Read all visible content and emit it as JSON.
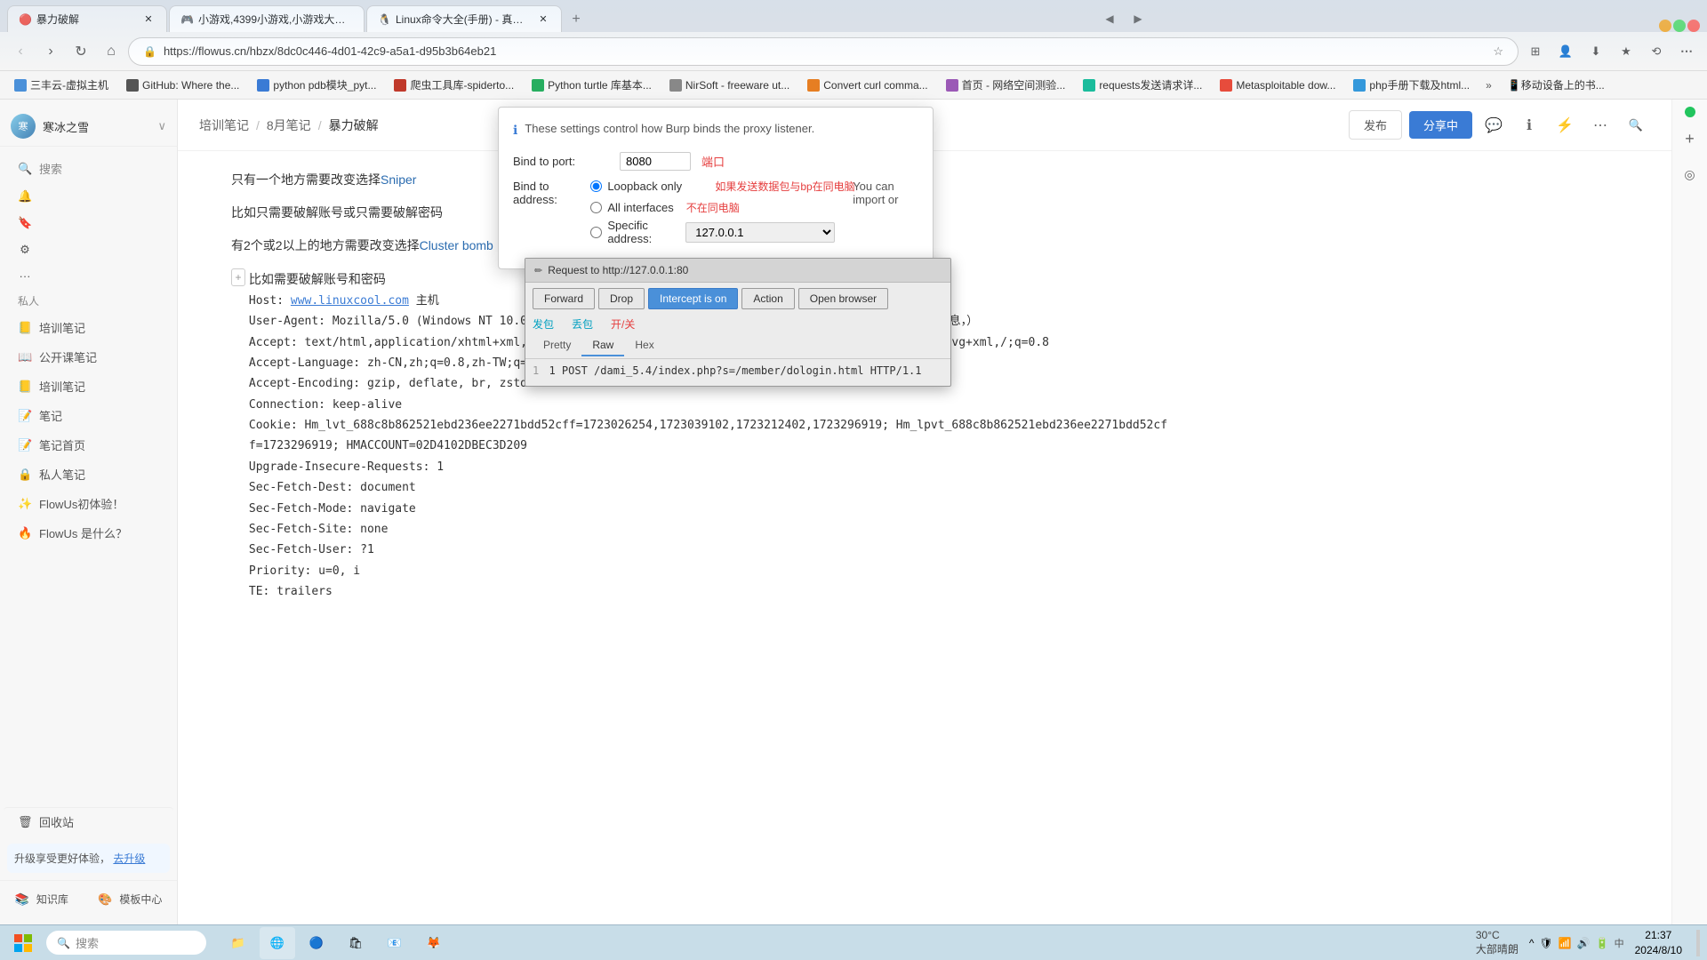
{
  "browser": {
    "tabs": [
      {
        "id": "tab1",
        "title": "暴力破解",
        "active": true,
        "favicon": "🔴"
      },
      {
        "id": "tab2",
        "title": "小游戏,4399小游戏,小游戏大全...",
        "active": false,
        "favicon": "🎮"
      },
      {
        "id": "tab3",
        "title": "Linux命令大全(手册) - 真正好...",
        "active": false,
        "favicon": "🐧"
      }
    ],
    "url": "https://flowus.cn/hbzx/8dc0c446-4d01-42c9-a5a1-d95b3b64eb21",
    "bookmarks": [
      "三丰云-虚拟主机",
      "GitHub: Where the...",
      "python pdb模块_pyt...",
      "爬虫工具库-spiderto...",
      "Python turtle 库基本...",
      "NirSoft - freeware ut...",
      "Convert curl comma...",
      "首页 - 网络空间测验...",
      "requests发送请求详...",
      "Metasploitable dow...",
      "php手册下载及html..."
    ]
  },
  "sidebar": {
    "user": {
      "name": "寒冰之雪",
      "avatar_text": "寒"
    },
    "sections": {
      "private_header": "私人",
      "items": [
        {
          "id": "training-notes",
          "label": "培训笔记",
          "icon": "📒"
        },
        {
          "id": "public-course",
          "label": "公开课笔记",
          "icon": "📖"
        },
        {
          "id": "training-notes2",
          "label": "培训笔记",
          "icon": "📒"
        },
        {
          "id": "notes",
          "label": "笔记",
          "icon": "📝"
        },
        {
          "id": "notes-home",
          "label": "笔记首页",
          "icon": "🏠"
        },
        {
          "id": "private-notes",
          "label": "私人笔记",
          "icon": "🔒"
        },
        {
          "id": "flowus-trial",
          "label": "FlowUs初体验！",
          "icon": "✨"
        },
        {
          "id": "what-is-flowus",
          "label": "FlowUs 是什么？",
          "icon": "❓"
        }
      ]
    },
    "trash": "回收站",
    "upgrade": {
      "text": "升级享受更好体验，",
      "btn_label": "去升级"
    },
    "library": {
      "knowledge": "知识库",
      "template_center": "模板中心"
    }
  },
  "breadcrumb": {
    "items": [
      "培训笔记",
      "8月笔记",
      "暴力破解"
    ]
  },
  "header_actions": {
    "publish_label": "发布",
    "share_label": "分享中",
    "comment_icon": "comment-icon",
    "info_icon": "info-icon",
    "lightning_icon": "lightning-icon",
    "more_icon": "more-icon",
    "search_icon": "search-icon"
  },
  "burp_settings": {
    "info_text": "These settings control how Burp binds the proxy listener.",
    "bind_port_label": "Bind to port:",
    "bind_port_value": "8080",
    "bind_address_label": "Bind to address:",
    "loopback_label": "Loopback only",
    "all_interfaces_label": "All interfaces",
    "specific_address_label": "Specific address:",
    "specific_address_value": "127.0.0.1",
    "annotation_port": "端口",
    "annotation_same_pc": "如果发送数据包与bp在同电脑",
    "annotation_diff_pc": "不在同电脑",
    "right_text": "You can import or"
  },
  "request_popup": {
    "title": "Request to http://127.0.0.1:80",
    "buttons": [
      {
        "id": "forward-btn",
        "label": "Forward"
      },
      {
        "id": "drop-btn",
        "label": "Drop"
      },
      {
        "id": "intercept-btn",
        "label": "Intercept is on",
        "primary": true
      },
      {
        "id": "action-btn",
        "label": "Action"
      },
      {
        "id": "open-browser-btn",
        "label": "Open browser"
      }
    ],
    "tabs": [
      {
        "id": "pretty-tab",
        "label": "Pretty"
      },
      {
        "id": "raw-tab",
        "label": "Raw"
      },
      {
        "id": "hex-tab",
        "label": "Hex"
      }
    ],
    "annotations": [
      {
        "text": "发包",
        "color": "cyan"
      },
      {
        "text": "丢包",
        "color": "cyan"
      },
      {
        "text": "开/关",
        "color": "red"
      }
    ],
    "content": "1 POST /dami_5.4/index.php?s=/member/dologin.html HTTP/1.1"
  },
  "page_content": {
    "line1": "只有一个地方需要改变选择Sniper",
    "line2": "比如只需要破解账号或只需要破解密码",
    "line3": "有2个或2以上的地方需要改变选择Cluster bomb",
    "line4": "比如需要破解账号和密码",
    "host_line": "Host: www.linuxcool.com 主机",
    "host_link": "www.linuxcool.com",
    "ua_line": "User-Agent: Mozilla/5.0 (Windows NT 10.0; Win64; x64; rv:129.0) Gecko/20100101 Firefox/129.0   (浏览器信息，）",
    "accept_line": "Accept: text/html,application/xhtml+xml,application/xml;q=0.9,image/avif,image/webp,image/png,image/svg+xml,/;q=0.8",
    "accept_lang_line": "Accept-Language: zh-CN,zh;q=0.8,zh-TW;q=0.7,zh-HK;q=0.5,en-US;q=0.3,en;q=0.2",
    "accept_enc_line": "Accept-Encoding: gzip, deflate, br, zstd",
    "connection_line": "Connection: keep-alive",
    "cookie_line": "Cookie: Hm_lvt_688c8b862521ebd236ee2271bdd52cff=1723026254,1723039102,1723212402,1723296919; Hm_lpvt_688c8b862521ebd236ee2271bdd52cff=1723296919; HMACCOUNT=02D4102DBEC3D209",
    "upgrade_insecure_line": "Upgrade-Insecure-Requests: 1",
    "sec_fetch_dest_line": "Sec-Fetch-Dest: document",
    "sec_fetch_mode_line": "Sec-Fetch-Mode: navigate",
    "sec_fetch_site_line": "Sec-Fetch-Site: none",
    "sec_fetch_user_line": "Sec-Fetch-User: ?1",
    "priority_line": "Priority: u=0, i",
    "te_line": "TE: trailers"
  },
  "taskbar": {
    "search_placeholder": "搜索",
    "time": "21:37",
    "date": "2024/8/10",
    "temp": "30°C",
    "weather_desc": "大部晴朗"
  }
}
